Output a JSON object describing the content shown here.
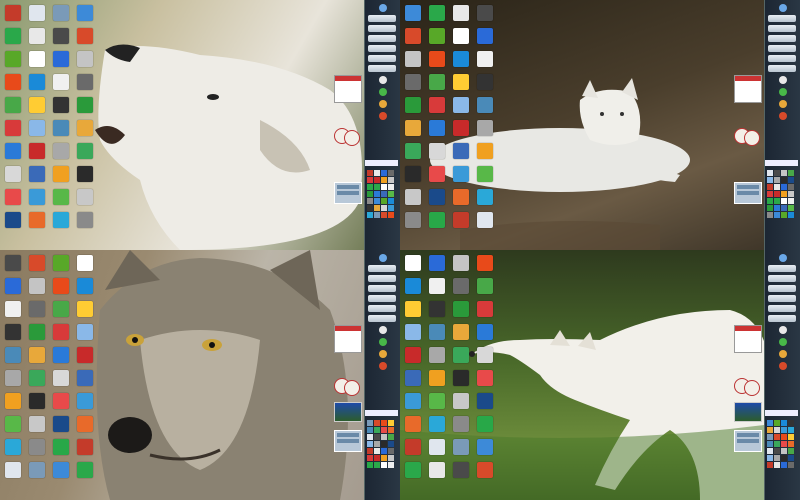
{
  "screens": [
    {
      "id": "screen-top-left",
      "wallpaper": "howling-white-wolf",
      "bg": "linear-gradient(120deg,#8a9a70 0%,#c9c0a0 30%,#e8e4da 60%,#5e6a40 100%)",
      "gadgets": {
        "calendar": true,
        "avatar": true,
        "weather": false
      }
    },
    {
      "id": "screen-top-right",
      "wallpaper": "white-wolf-lying-on-ground",
      "bg": "linear-gradient(160deg,#2a2418 0%,#4a3e2c 45%,#6a5a44 70%,#3a3226 100%)",
      "gadgets": {
        "calendar": true,
        "avatar": true,
        "weather": false
      }
    },
    {
      "id": "screen-bottom-left",
      "wallpaper": "grey-wolf-closeup",
      "bg": "linear-gradient(110deg,#8a7a60 0%,#9a8a70 30%,#bbb5a8 55%,#a0968a 100%)",
      "gadgets": {
        "calendar": true,
        "avatar": true,
        "weather": true
      }
    },
    {
      "id": "screen-bottom-right",
      "wallpaper": "white-wolf-stretching-in-grass",
      "bg": "linear-gradient(180deg,#2e3a1e 0%,#4a6a2a 45%,#6a8a3a 75%,#3e5a22 100%)",
      "gadgets": {
        "calendar": true,
        "avatar": true,
        "weather": true
      }
    }
  ],
  "desktop_icon_colors": [
    "#c43b2a",
    "#e0e6ee",
    "#7a9ab8",
    "#3d8ad8",
    "#2aa84a",
    "#e8e8e8",
    "#4a4a4a",
    "#d84a2a",
    "#58a828",
    "#ffffff",
    "#2a6ad8",
    "#c4c4c4",
    "#e84a1a",
    "#1a8ad8",
    "#f0f0f0",
    "#6a6a6a",
    "#48a848",
    "#ffcc33",
    "#333333",
    "#2a9a3a",
    "#d83a3a",
    "#8ab8e8",
    "#4a8ab8",
    "#e8a83a",
    "#2a7ad8",
    "#c82a2a",
    "#a8a8a8",
    "#3aa85a",
    "#d8d8d8",
    "#3a6ab8",
    "#f0a020",
    "#2a2a2a",
    "#e84a4a",
    "#3a9ad8",
    "#58b848",
    "#c8c8c8",
    "#1a4a8a",
    "#e86a2a",
    "#2aa8d8",
    "#8a8a8a",
    "#28a848"
  ]
}
